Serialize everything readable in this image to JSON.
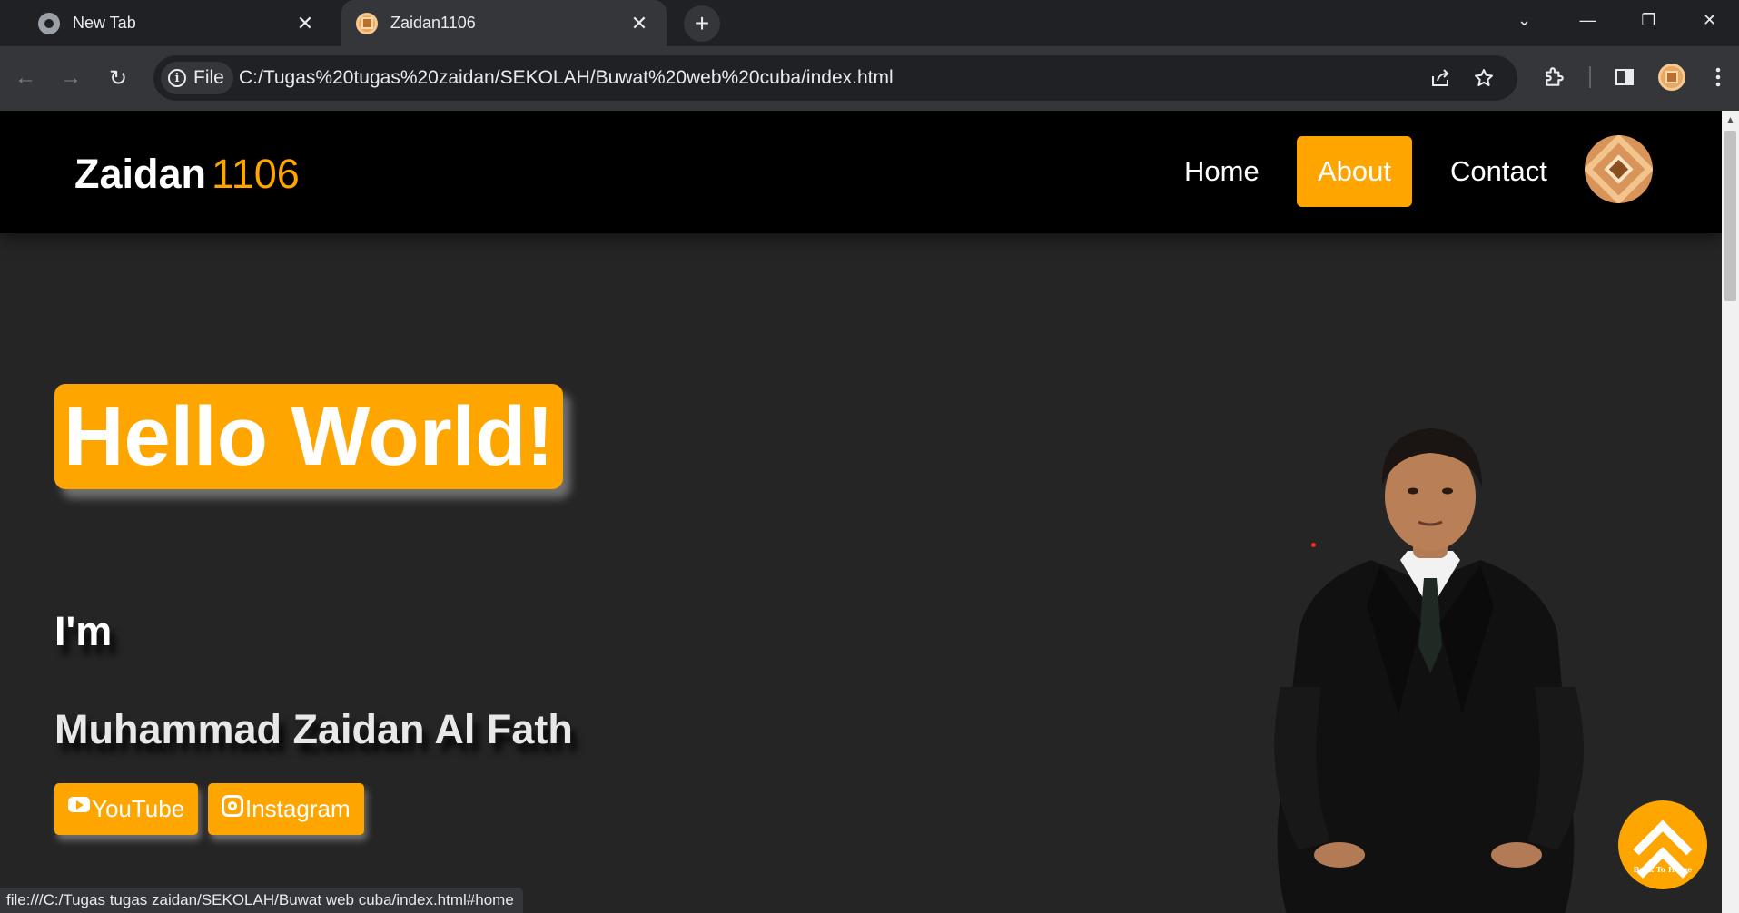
{
  "browser": {
    "tabs": [
      {
        "title": "New Tab",
        "icon": "chrome-icon",
        "active": false
      },
      {
        "title": "Zaidan1106",
        "icon": "site-favicon",
        "active": true
      }
    ],
    "new_tab_symbol": "+",
    "close_symbol": "✕",
    "window_controls": {
      "dropdown": "⌄",
      "minimize": "—",
      "restore": "❐",
      "close": "✕"
    },
    "nav": {
      "back": "←",
      "forward": "→",
      "reload": "↻"
    },
    "address": {
      "chip_label": "File",
      "info_symbol": "i",
      "url": "C:/Tugas%20tugas%20zaidan/SEKOLAH/Buwat%20web%20cuba/index.html"
    },
    "status_url": "file:///C:/Tugas tugas zaidan/SEKOLAH/Buwat web cuba/index.html#home"
  },
  "site": {
    "logo": {
      "name": "Zaidan",
      "accent": "1106"
    },
    "nav": [
      {
        "label": "Home",
        "active": false
      },
      {
        "label": "About",
        "active": true
      },
      {
        "label": "Contact",
        "active": false
      }
    ],
    "hero": {
      "headline": "Hello World!",
      "intro": "I'm",
      "full_name": "Muhammad Zaidan Al Fath",
      "buttons": [
        {
          "label": "YouTube",
          "icon": "youtube-icon"
        },
        {
          "label": "Instagram",
          "icon": "instagram-icon"
        }
      ]
    },
    "back_to_home_label": "Back To Home",
    "colors": {
      "accent": "#ffa500",
      "header_bg": "#000000",
      "page_bg": "#252525"
    }
  }
}
